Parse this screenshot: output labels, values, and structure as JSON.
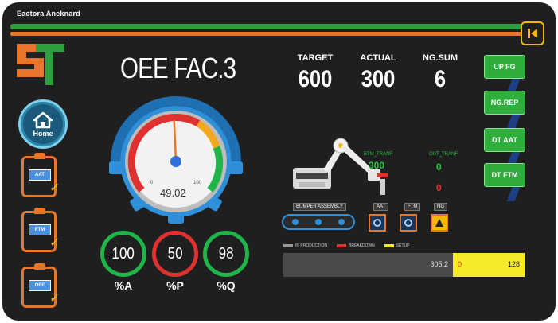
{
  "window": {
    "title": "Eactora Aneknard"
  },
  "sidebar": {
    "home_label": "Home",
    "items": [
      {
        "label": "AAT",
        "icon": "clipboard-check-icon"
      },
      {
        "label": "FTM",
        "icon": "clipboard-check-icon"
      },
      {
        "label": "OEE",
        "icon": "clipboard-check-icon"
      }
    ]
  },
  "header": {
    "title": "OEE FAC.3"
  },
  "kpis": [
    {
      "label": "TARGET",
      "value": "600"
    },
    {
      "label": "ACTUAL",
      "value": "300"
    },
    {
      "label": "NG.SUM",
      "value": "6"
    }
  ],
  "gauge": {
    "value": "49.02",
    "level": 49.02,
    "min_label": "0",
    "max_label": "100"
  },
  "metrics": [
    {
      "value": "100",
      "label": "%A",
      "ring_color": "#1fb548"
    },
    {
      "value": "50",
      "label": "%P",
      "ring_color": "#e03131"
    },
    {
      "value": "98",
      "label": "%Q",
      "ring_color": "#1fb548"
    }
  ],
  "right_buttons": [
    {
      "label": "UP FG"
    },
    {
      "label": "NG.REP"
    },
    {
      "label": "DT AAT"
    },
    {
      "label": "DT FTM"
    }
  ],
  "station": {
    "left_label": "BTM_TRANF",
    "left_value": "300",
    "right_label": "OUT_TRANF",
    "right_value": "0",
    "right_value2": "0",
    "assembly_tag": "BUMPER ASSEMBLY",
    "tools": [
      "AAT",
      "FTM",
      "NG"
    ]
  },
  "status": {
    "legend": [
      "IN PRODUCTION",
      "BREAKDOWN",
      "SETUP"
    ],
    "legend_colors": [
      "#9a9a9a",
      "#e03131",
      "#f4e92a"
    ],
    "gray_value": "305.2",
    "red_value": "0",
    "yellow_value": "128"
  },
  "colors": {
    "background": "#1f1f1f",
    "accent_orange": "#e8752a",
    "accent_green": "#2fae3b",
    "accent_yellow": "#f2b900",
    "home_blue": "#1b5a7a"
  }
}
